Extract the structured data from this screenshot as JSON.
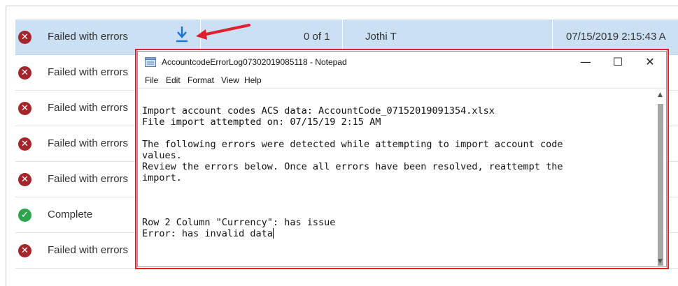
{
  "rows": [
    {
      "status": "Failed with errors",
      "kind": "fail",
      "count": "0 of 1",
      "user": "Jothi T",
      "date": "07/15/2019 2:15:43 A"
    },
    {
      "status": "Failed with errors",
      "kind": "fail"
    },
    {
      "status": "Failed with errors",
      "kind": "fail"
    },
    {
      "status": "Failed with errors",
      "kind": "fail"
    },
    {
      "status": "Failed with errors",
      "kind": "fail"
    },
    {
      "status": "Complete",
      "kind": "ok"
    },
    {
      "status": "Failed with errors",
      "kind": "fail"
    }
  ],
  "status_icons": {
    "fail": "x-circle-icon",
    "ok": "check-circle-icon"
  },
  "download_icon": "download-icon",
  "colors": {
    "fail": "#a4262c",
    "ok": "#2ea44f",
    "selected_row": "#cce0f4",
    "download": "#1a73d9",
    "highlight": "#e0202a"
  },
  "notepad": {
    "title": "AccountcodeErrorLog07302019085118 - Notepad",
    "menu": [
      "File",
      "Edit",
      "Format",
      "View",
      "Help"
    ],
    "lines": [
      "Import account codes ACS data: AccountCode_07152019091354.xlsx",
      "File import attempted on: 07/15/19 2:15 AM",
      "",
      "The following errors were detected while attempting to import account code",
      "values.",
      "Review the errors below. Once all errors have been resolved, reattempt the",
      "import.",
      "",
      "",
      "",
      "Row 2 Column \"Currency\": has issue",
      "Error: has invalid data"
    ],
    "minimize": "—",
    "maximize": "☐",
    "close": "✕"
  }
}
